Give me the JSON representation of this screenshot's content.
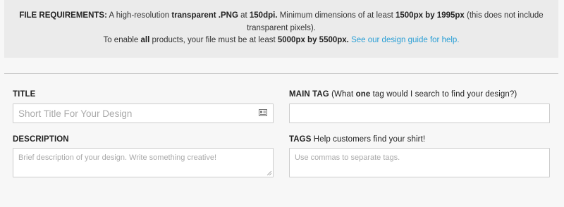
{
  "requirements": {
    "prefix": "FILE REQUIREMENTS:",
    "t1": " A high-resolution ",
    "b1": "transparent .PNG",
    "t2": " at ",
    "b2": "150dpi.",
    "t3": " Minimum dimensions of at least ",
    "b3": "1500px by 1995px",
    "t4": " (this does not include transparent pixels).",
    "t5": "To enable ",
    "b4": "all",
    "t6": " products, your file must be at least ",
    "b5": "5000px by 5500px.",
    "link": "See our design guide for help."
  },
  "fields": {
    "title": {
      "label": "TITLE",
      "placeholder": "Short Title For Your Design",
      "value": ""
    },
    "main_tag": {
      "label": "MAIN TAG",
      "hint_pre": " (What ",
      "hint_bold": "one",
      "hint_post": " tag would I search to find your design?)",
      "value": ""
    },
    "description": {
      "label": "DESCRIPTION",
      "placeholder": "Brief description of your design. Write something creative!",
      "value": ""
    },
    "tags": {
      "label": "TAGS",
      "hint": " Help customers find your shirt!",
      "placeholder": "Use commas to separate tags.",
      "value": ""
    }
  },
  "icons": {
    "title_field": "contact-card-icon",
    "textarea": "resize-grip-icon"
  },
  "colors": {
    "link": "#2a9fd6",
    "info_bg": "#ebebeb",
    "page_bg": "#f7f7f7"
  }
}
